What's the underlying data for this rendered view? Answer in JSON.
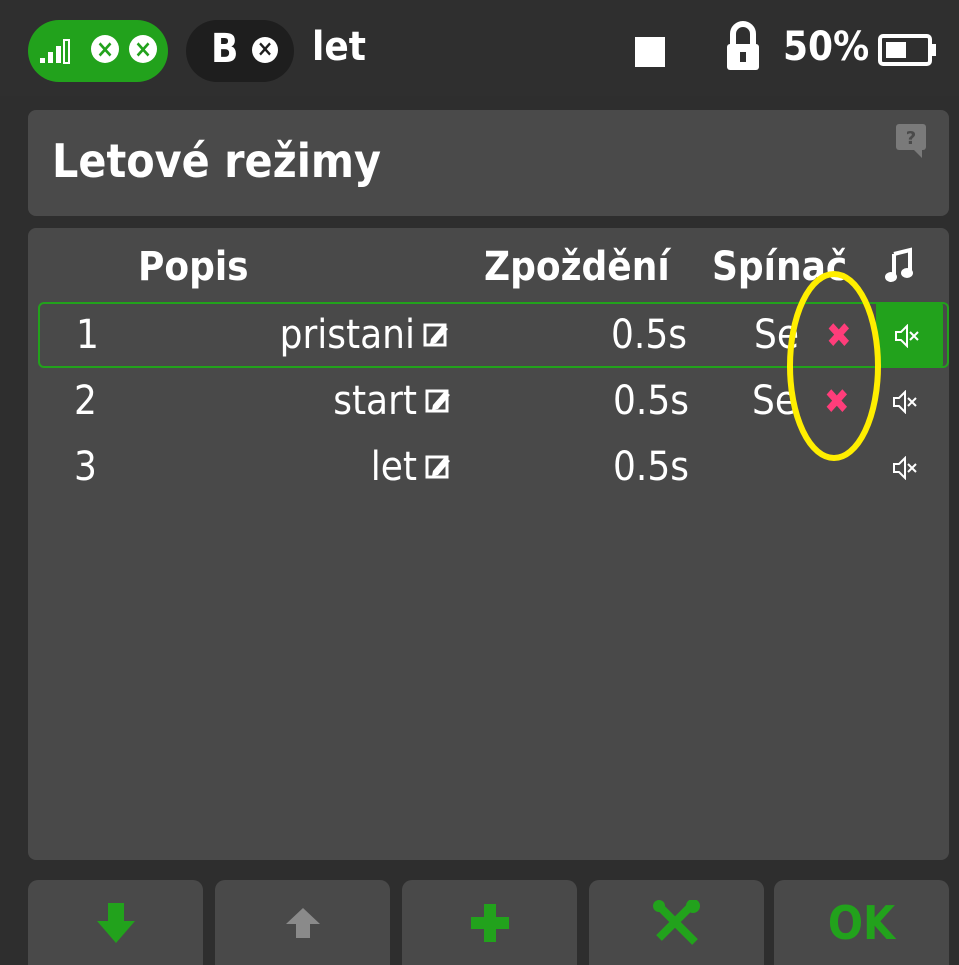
{
  "status_bar": {
    "receiver_icon": "signal-bars-icon",
    "receiver_x_icons": [
      "close-circle-icon",
      "close-circle-icon"
    ],
    "pill_label": "B",
    "pill_x_icon": "close-circle-icon",
    "flight_mode": "let",
    "battery_percent": "50%"
  },
  "header": {
    "title": "Letové režimy",
    "help_icon": "help-icon"
  },
  "table": {
    "columns": [
      "Popis",
      "Zpoždění",
      "Spínač"
    ],
    "music_icon": "music-note-icon",
    "rows": [
      {
        "num": "1",
        "name": "pristani",
        "delay": "0.5s",
        "switch": "Se",
        "x": "✖",
        "selected": true
      },
      {
        "num": "2",
        "name": "start",
        "delay": "0.5s",
        "switch": "Se",
        "x": "✖",
        "selected": false
      },
      {
        "num": "3",
        "name": "let",
        "delay": "0.5s",
        "switch": "",
        "x": "",
        "selected": false
      }
    ]
  },
  "toolbar": {
    "buttons": [
      "arrow-down-icon",
      "arrow-up-icon",
      "plus-icon",
      "tools-icon",
      "ok-button"
    ],
    "ok_label": "OK"
  },
  "colors": {
    "accent_green": "#22a21c",
    "panel": "#494949",
    "background": "#2e2e2e",
    "error_pink": "#ff3d7a",
    "annotation_yellow": "#ffee00"
  }
}
